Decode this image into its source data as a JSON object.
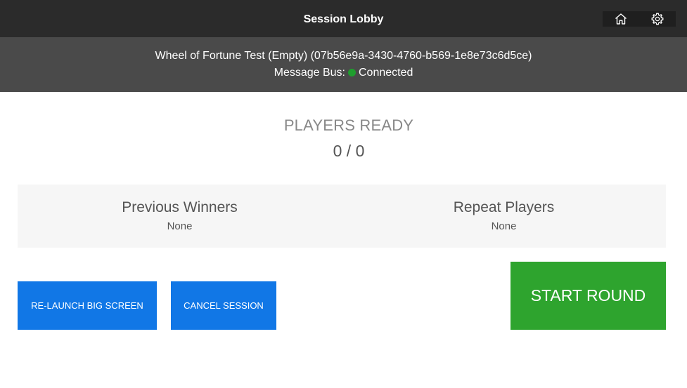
{
  "header": {
    "title": "Session Lobby",
    "icons": {
      "home": "home-icon",
      "settings": "gear-icon"
    }
  },
  "session": {
    "title": "Wheel of Fortune Test (Empty) (07b56e9a-3430-4760-b569-1e8e73c6d5ce)",
    "bus_label": "Message Bus:",
    "bus_status": "Connected",
    "bus_status_color": "#1f9e2e"
  },
  "players": {
    "label": "PLAYERS READY",
    "count": "0 / 0"
  },
  "stats": {
    "previous_winners": {
      "title": "Previous Winners",
      "value": "None"
    },
    "repeat_players": {
      "title": "Repeat Players",
      "value": "None"
    }
  },
  "actions": {
    "relaunch_label": "RE-LAUNCH BIG SCREEN",
    "cancel_label": "CANCEL SESSION",
    "start_label": "START ROUND"
  },
  "colors": {
    "topbar": "#2b2b2b",
    "infobar": "#4a4a4a",
    "primary": "#1177e6",
    "success": "#2ea42e"
  }
}
